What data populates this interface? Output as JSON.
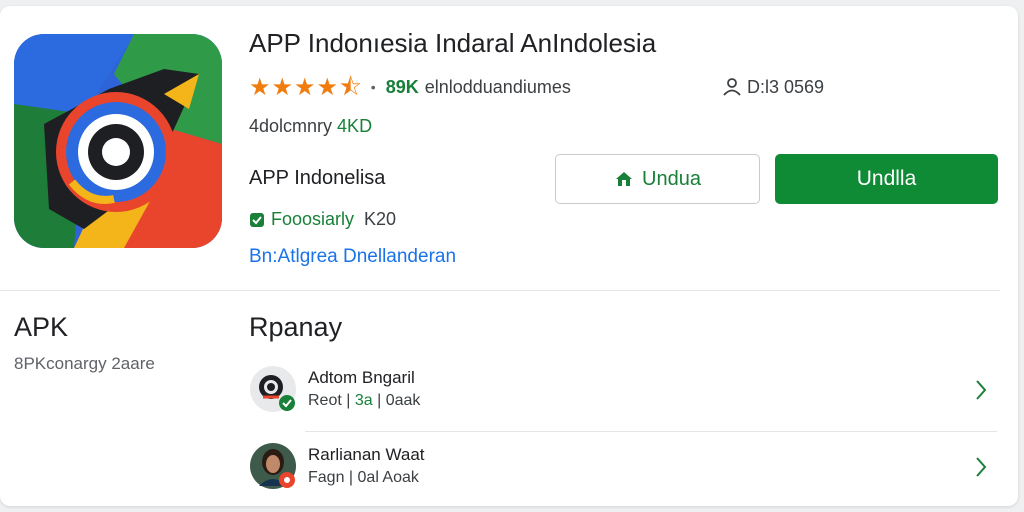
{
  "app": {
    "title": "APP Indonıesia Indaral AnIndolesia",
    "rating_stars": 4.5,
    "reviews_count": "89K",
    "reviews_label": "elnlodduandiumes",
    "downloads_text": "D:l3 0569",
    "size_prefix": "4dolcmnry",
    "size_value": "4KD",
    "subtitle": "APP Indonelisa",
    "verified_label": "Fooosiarly",
    "verified_value": "K20",
    "developer_link": "Bn:Atlgrea Dnellanderan"
  },
  "buttons": {
    "secondary_label": "Undua",
    "primary_label": "Undlla"
  },
  "apk_section": {
    "title": "APK",
    "subtitle": "8PKconargy 2aare"
  },
  "related": {
    "title": "Rpanay",
    "items": [
      {
        "name": "Adtom Bngaril",
        "meta_prefix": "Reot | ",
        "meta_accent": "3a",
        "meta_suffix": " | 0aak"
      },
      {
        "name": "Rarlianan Waat",
        "meta_prefix": "Fagn | 0al Aoak",
        "meta_accent": "",
        "meta_suffix": ""
      }
    ]
  },
  "colors": {
    "accent_green": "#188038",
    "primary_button": "#0f8a35",
    "link_blue": "#1a73e8",
    "star_orange": "#f07c0d"
  }
}
